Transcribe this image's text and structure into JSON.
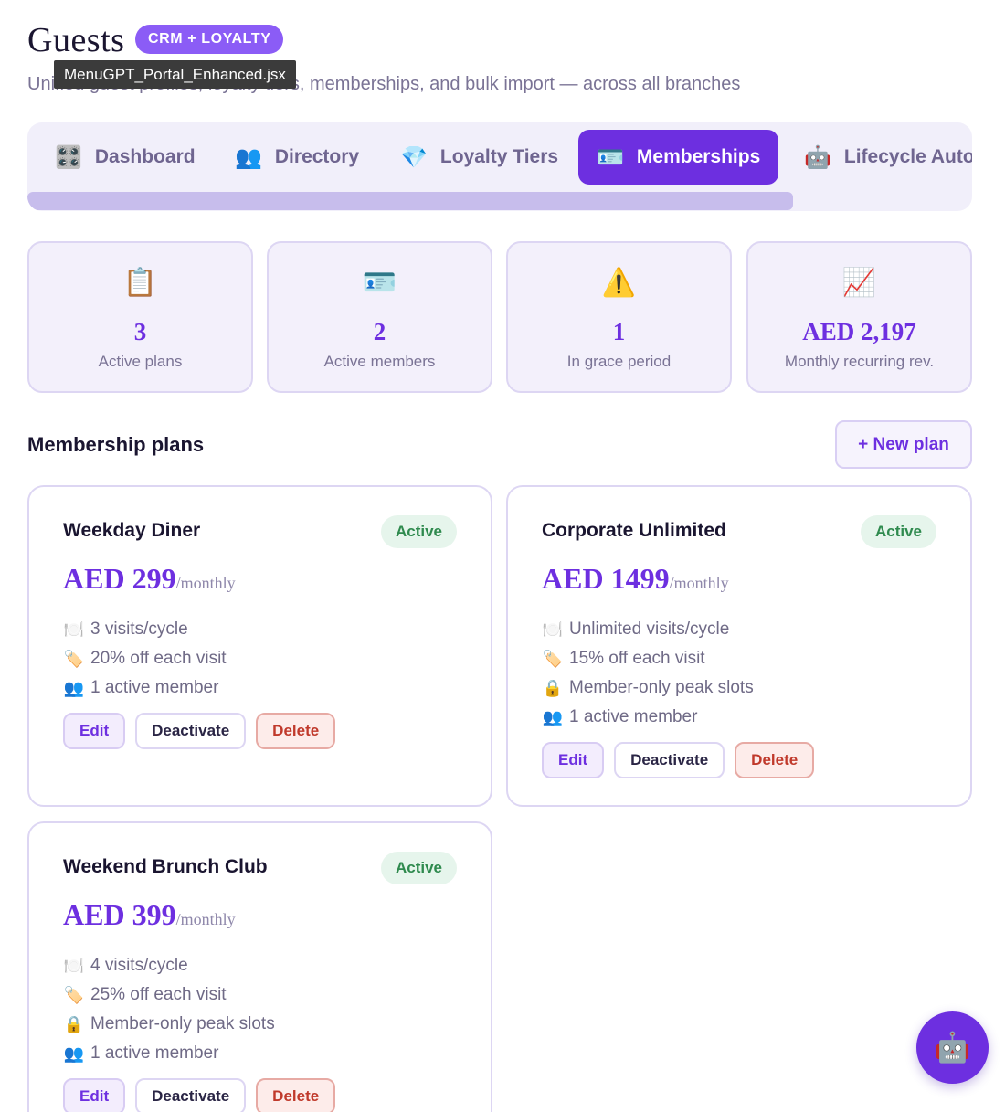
{
  "header": {
    "title": "Guests",
    "badge": "CRM + LOYALTY",
    "subtitle": "Unified guest profiles, loyalty tiers, memberships, and bulk import — across all branches",
    "tooltip": "MenuGPT_Portal_Enhanced.jsx"
  },
  "tabs": [
    {
      "label": "Dashboard",
      "icon": "🎛️",
      "active": false
    },
    {
      "label": "Directory",
      "icon": "👥",
      "active": false
    },
    {
      "label": "Loyalty Tiers",
      "icon": "💎",
      "active": false
    },
    {
      "label": "Memberships",
      "icon": "🪪",
      "active": true
    },
    {
      "label": "Lifecycle Autor",
      "icon": "🤖",
      "active": false
    }
  ],
  "stats": [
    {
      "icon": "📋",
      "value": "3",
      "label": "Active plans"
    },
    {
      "icon": "🪪",
      "value": "2",
      "label": "Active members"
    },
    {
      "icon": "⚠️",
      "value": "1",
      "label": "In grace period"
    },
    {
      "icon": "📈",
      "value": "AED 2,197",
      "label": "Monthly recurring rev."
    }
  ],
  "plans_section": {
    "title": "Membership plans",
    "new_plan_label": "+ New plan"
  },
  "plans": [
    {
      "name": "Weekday Diner",
      "status": "Active",
      "price": "AED 299",
      "period": "/monthly",
      "features": [
        {
          "icon": "🍽️",
          "text": "3 visits/cycle"
        },
        {
          "icon": "🏷️",
          "text": "20% off each visit"
        },
        {
          "icon": "👥",
          "text": "1 active member"
        }
      ],
      "actions": {
        "edit": "Edit",
        "deactivate": "Deactivate",
        "delete": "Delete"
      }
    },
    {
      "name": "Corporate Unlimited",
      "status": "Active",
      "price": "AED 1499",
      "period": "/monthly",
      "features": [
        {
          "icon": "🍽️",
          "text": "Unlimited visits/cycle"
        },
        {
          "icon": "🏷️",
          "text": "15% off each visit"
        },
        {
          "icon": "🔒",
          "text": "Member-only peak slots"
        },
        {
          "icon": "👥",
          "text": "1 active member"
        }
      ],
      "actions": {
        "edit": "Edit",
        "deactivate": "Deactivate",
        "delete": "Delete"
      }
    },
    {
      "name": "Weekend Brunch Club",
      "status": "Active",
      "price": "AED 399",
      "period": "/monthly",
      "features": [
        {
          "icon": "🍽️",
          "text": "4 visits/cycle"
        },
        {
          "icon": "🏷️",
          "text": "25% off each visit"
        },
        {
          "icon": "🔒",
          "text": "Member-only peak slots"
        },
        {
          "icon": "👥",
          "text": "1 active member"
        }
      ],
      "actions": {
        "edit": "Edit",
        "deactivate": "Deactivate",
        "delete": "Delete"
      }
    }
  ],
  "fab": {
    "icon": "🤖"
  }
}
